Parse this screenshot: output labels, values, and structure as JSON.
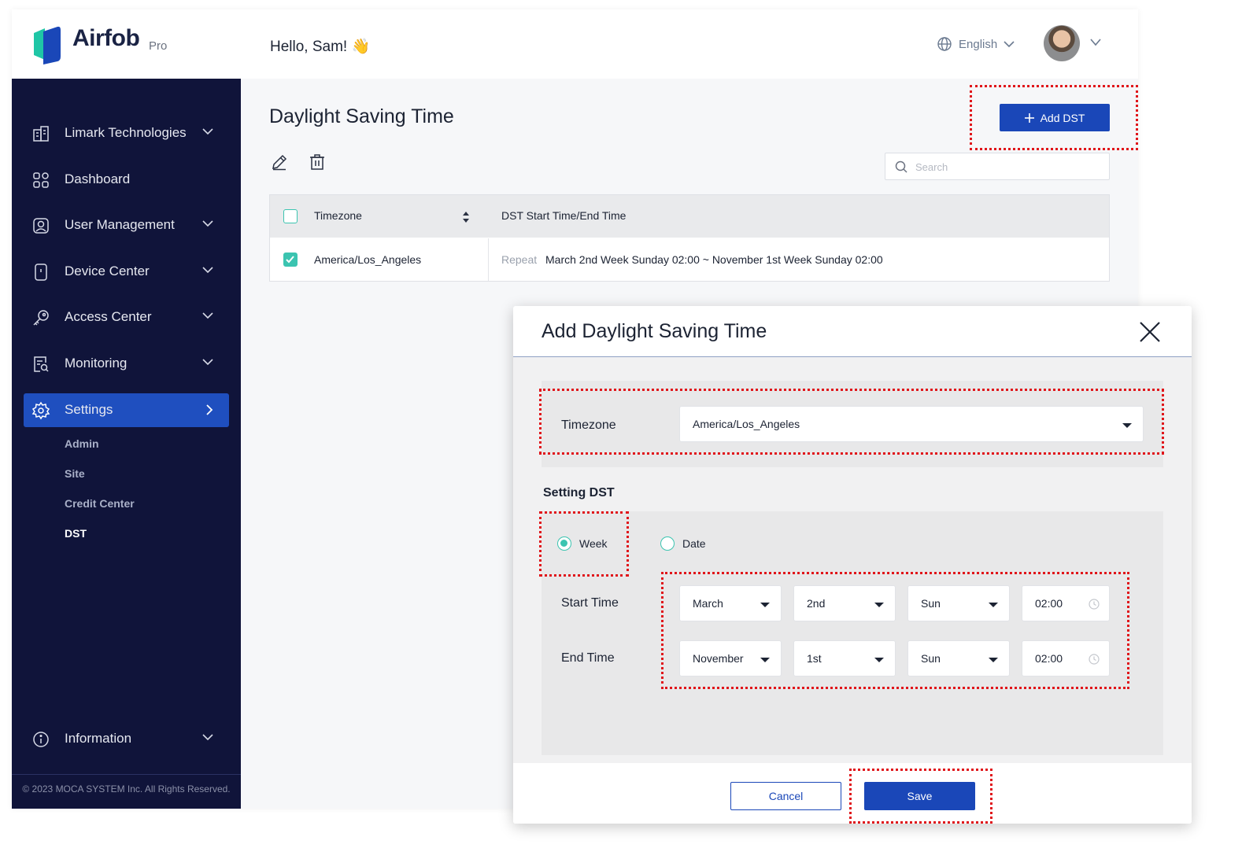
{
  "brand": {
    "name": "Airfob",
    "tier": "Pro"
  },
  "header": {
    "greeting": "Hello, Sam! 👋",
    "language": "English"
  },
  "sidebar": {
    "items": [
      {
        "label": "Limark Technologies",
        "icon": "building-icon",
        "has_chevron": true
      },
      {
        "label": "Dashboard",
        "icon": "dashboard-icon",
        "has_chevron": false
      },
      {
        "label": "User Management",
        "icon": "user-icon",
        "has_chevron": true
      },
      {
        "label": "Device Center",
        "icon": "device-icon",
        "has_chevron": true
      },
      {
        "label": "Access Center",
        "icon": "key-icon",
        "has_chevron": true
      },
      {
        "label": "Monitoring",
        "icon": "monitoring-icon",
        "has_chevron": true
      },
      {
        "label": "Settings",
        "icon": "gear-icon",
        "active": true
      }
    ],
    "settings_sub": [
      "Admin",
      "Site",
      "Credit Center",
      "DST"
    ],
    "current_sub": "DST",
    "information": "Information",
    "copyright": "© 2023 MOCA SYSTEM Inc. All Rights Reserved."
  },
  "main": {
    "title": "Daylight Saving Time",
    "add_button": "Add DST",
    "search_placeholder": "Search",
    "table": {
      "headers": [
        "Timezone",
        "DST Start Time/End Time"
      ],
      "rows": [
        {
          "checked": true,
          "timezone": "America/Los_Angeles",
          "repeat": "Repeat",
          "range": "March 2nd Week Sunday 02:00 ~ November 1st Week Sunday 02:00"
        }
      ]
    }
  },
  "modal": {
    "title": "Add Daylight Saving Time",
    "timezone_label": "Timezone",
    "timezone_value": "America/Los_Angeles",
    "setting_title": "Setting DST",
    "radio_week": "Week",
    "radio_date": "Date",
    "selected_mode": "Week",
    "start_label": "Start Time",
    "end_label": "End Time",
    "start": {
      "month": "March",
      "week": "2nd",
      "day": "Sun",
      "time": "02:00"
    },
    "end": {
      "month": "November",
      "week": "1st",
      "day": "Sun",
      "time": "02:00"
    },
    "cancel": "Cancel",
    "save": "Save"
  },
  "colors": {
    "accent": "#1a47b8",
    "sidebar": "#10143a",
    "teal": "#3bc4b0",
    "highlight": "#e0151a"
  }
}
